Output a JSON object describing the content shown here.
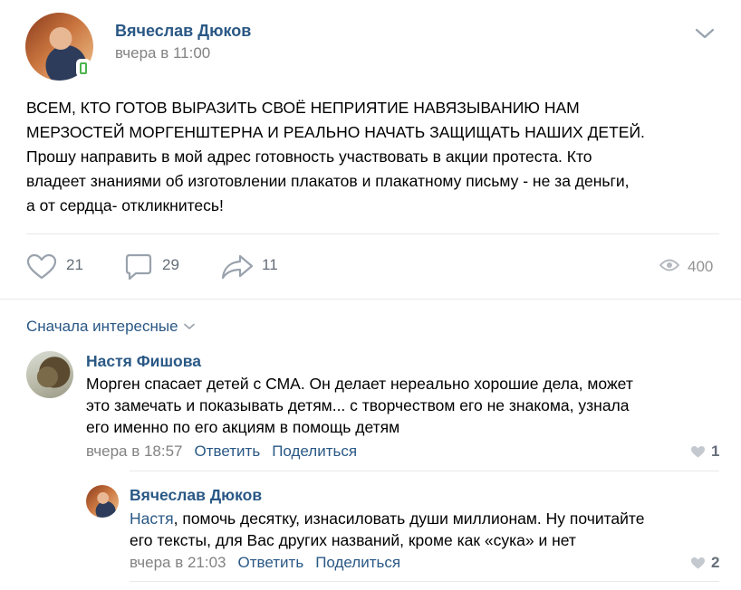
{
  "post": {
    "author": "Вячеслав Дюков",
    "time": "вчера в 11:00",
    "text_line1": "ВСЕМ, КТО ГОТОВ ВЫРАЗИТЬ СВОЁ НЕПРИЯТИЕ НАВЯЗЫВАНИЮ НАМ",
    "text_line2": "МЕРЗОСТЕЙ МОРГЕНШТЕРНА И РЕАЛЬНО НАЧАТЬ ЗАЩИЩАТЬ НАШИХ ДЕТЕЙ.",
    "text_line3": "Прошу направить в мой адрес готовность участвовать в акции протеста. Кто",
    "text_line4": "владеет знаниями об изготовлении плакатов и плакатному письму - не за деньги,",
    "text_line5": "а от сердца- откликнитесь!",
    "likes": "21",
    "comments": "29",
    "shares": "11",
    "views": "400"
  },
  "comments_section": {
    "sort_label": "Сначала интересные"
  },
  "comment1": {
    "author": "Настя Фишова",
    "line1": "Морген спасает детей с СМА. Он делает нереально хорошие дела, может",
    "line2": "это замечать и показывать детям... с творчеством его не знакома, узнала",
    "line3": "его именно по его акциям в помощь детям",
    "time": "вчера в 18:57",
    "reply": "Ответить",
    "share": "Поделиться",
    "likes": "1"
  },
  "comment2": {
    "author": "Вячеслав Дюков",
    "mention": "Настя",
    "line1_rest": ", помочь десятку, изнасиловать души миллионам. Ну почитайте",
    "line2": "его тексты, для Вас других названий, кроме как «сука» и нет",
    "time": "вчера в 21:03",
    "reply": "Ответить",
    "share": "Поделиться",
    "likes": "2"
  },
  "colors": {
    "link": "#2a5885",
    "meta": "#828282",
    "icon": "#99a2ad",
    "online_badge": "#4bb34b"
  }
}
